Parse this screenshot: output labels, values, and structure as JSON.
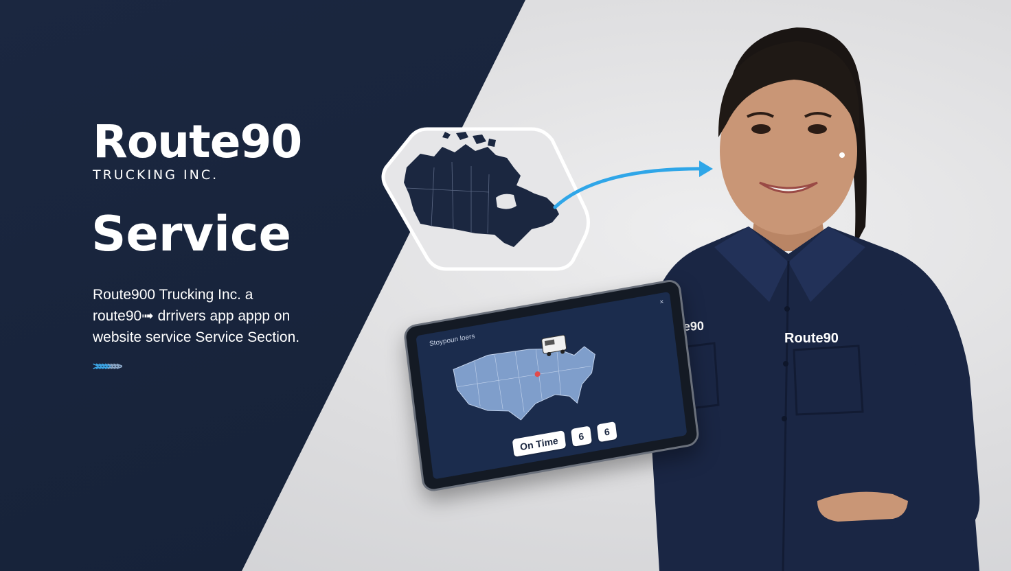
{
  "brand": {
    "name": "Route90",
    "subtitle": "TRUCKING INC."
  },
  "section": {
    "heading": "Service",
    "description_lines": [
      "Route900 Trucking Inc. a",
      "route90➟ drrivers app appp on",
      "website service Service Section."
    ]
  },
  "uniform": {
    "chest_logo_left": "Route90",
    "chest_logo_right": "Route90"
  },
  "tablet": {
    "app_title": "Stoypoun loers",
    "close_glyph": "×",
    "stats": [
      "On Time",
      "6",
      "6"
    ]
  },
  "colors": {
    "dark_panel": "#17233a",
    "accent_blue": "#2fa6e8",
    "uniform_navy": "#1a2644",
    "background": "#e1e1e3"
  },
  "icons": [
    "canada-map-icon",
    "arrow-right-icon",
    "chevrons-right-icon",
    "us-map-icon",
    "truck-icon",
    "location-pin-icon"
  ]
}
